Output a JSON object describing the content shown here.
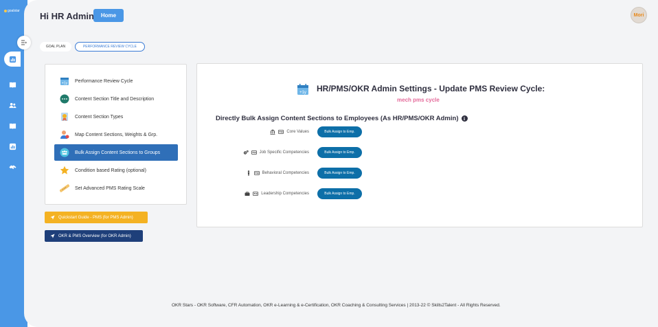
{
  "brand": {
    "name": "goalstar"
  },
  "header": {
    "greeting": "Hi HR Admin",
    "home_label": "Home",
    "avatar_text": "Mori"
  },
  "subtabs": {
    "goal_plan": "GOAL PLAN",
    "review_cycle": "PERFORMANCE REVIEW CYCLE"
  },
  "menu": {
    "items": [
      {
        "label": "Performance Review Cycle",
        "icon": "calendar-icon"
      },
      {
        "label": "Content Section Title and Description",
        "icon": "dots-icon"
      },
      {
        "label": "Content Section Types",
        "icon": "badge-icon"
      },
      {
        "label": "Map Content Sections, Weights & Grp.",
        "icon": "user-map-icon"
      },
      {
        "label": "Bulk Assign Content Sections to Groups",
        "icon": "group-icon"
      },
      {
        "label": "Condition based Rating (optional)",
        "icon": "star-icon"
      },
      {
        "label": "Set Advanced PMS Rating Scale",
        "icon": "ruler-icon"
      }
    ],
    "active_index": 4
  },
  "quickstart_label": "Quickstart Guide - PMS (for PMS Admin)",
  "okr_overview_label": "OKR & PMS Overview (for OKR Admin)",
  "main": {
    "title": "HR/PMS/OKR Admin Settings - Update PMS Review Cycle:",
    "cycle_name": "mech pms cycle",
    "heading": "Directly Bulk Assign Content Sections to Employees (As HR/PMS/OKR Admin)",
    "sections": [
      {
        "label": "Core Values",
        "icon": "bank-icon",
        "button": "Bulk Assign to Emp."
      },
      {
        "label": "Job Specific Competencies",
        "icon": "gears-icon",
        "button": "Bulk Assign to Emp."
      },
      {
        "label": "Behavioral Competencies",
        "icon": "person-icon",
        "button": "Bulk Assign to Emp."
      },
      {
        "label": "Leadership Competencies",
        "icon": "briefcase-icon",
        "button": "Bulk Assign to Emp."
      }
    ]
  },
  "footer": "OKR Stars - OKR Software, CFR Automation, OKR e-Learning & e-Certification, OKR Coaching & Consulting Services | 2013-22 © Skills2Talent - All Rights Reserved.",
  "colors": {
    "accent": "#4a97e6",
    "active_menu": "#2f6fb8",
    "bulk_button": "#0d6fa8",
    "quickstart": "#f4b223",
    "okr_button": "#1e3f7a",
    "cycle_name": "#e46a9a"
  }
}
